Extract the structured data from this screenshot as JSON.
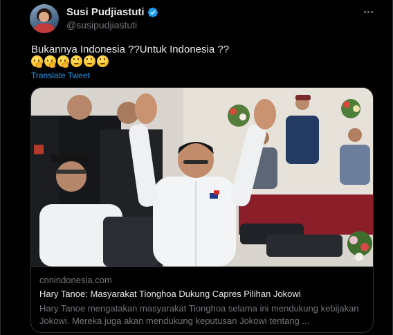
{
  "author": {
    "name": "Susi Pudjiastuti",
    "handle": "@susipudjiastuti",
    "verified": true,
    "avatar_icon": "profile-photo"
  },
  "tweet": {
    "text": "Bukannya Indonesia ??Untuk Indonesia ??",
    "emojis": [
      "thinking-face",
      "thinking-face",
      "thinking-face",
      "face-with-rolling-eyes",
      "face-with-rolling-eyes",
      "face-with-rolling-eyes"
    ],
    "translate_label": "Translate Tweet"
  },
  "card": {
    "domain": "cnnindonesia.com",
    "title": "Hary Tanoe: Masyarakat Tionghoa Dukung Capres Pilihan Jokowi",
    "description": "Hary Tanoe mengatakan masyarakat Tionghoa selama ini mendukung kebijakan Jokowi. Mereka juga akan mendukung keputusan Jokowi tentang ..."
  },
  "colors": {
    "background": "#000000",
    "text_primary": "#e7e9ea",
    "text_secondary": "#71767b",
    "link": "#1d9bf0",
    "verified_badge": "#1d9bf0",
    "border": "#2f3336"
  }
}
